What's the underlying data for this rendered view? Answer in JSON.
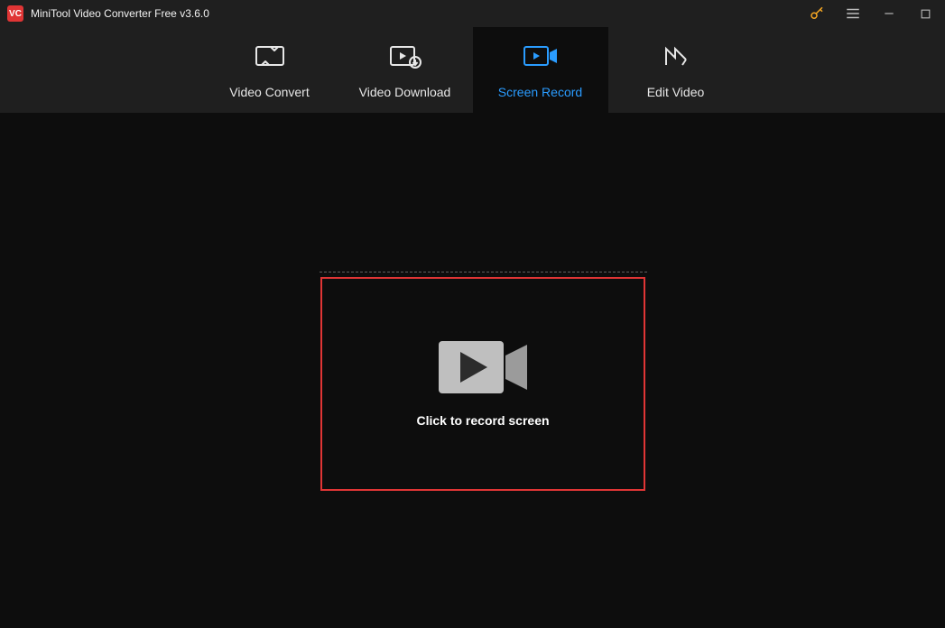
{
  "app": {
    "badge": "VC",
    "title": "MiniTool Video Converter Free v3.6.0"
  },
  "tabs": {
    "items": [
      {
        "label": "Video Convert"
      },
      {
        "label": "Video Download"
      },
      {
        "label": "Screen Record"
      },
      {
        "label": "Edit Video"
      }
    ]
  },
  "screen_record": {
    "prompt": "Click to record screen"
  }
}
